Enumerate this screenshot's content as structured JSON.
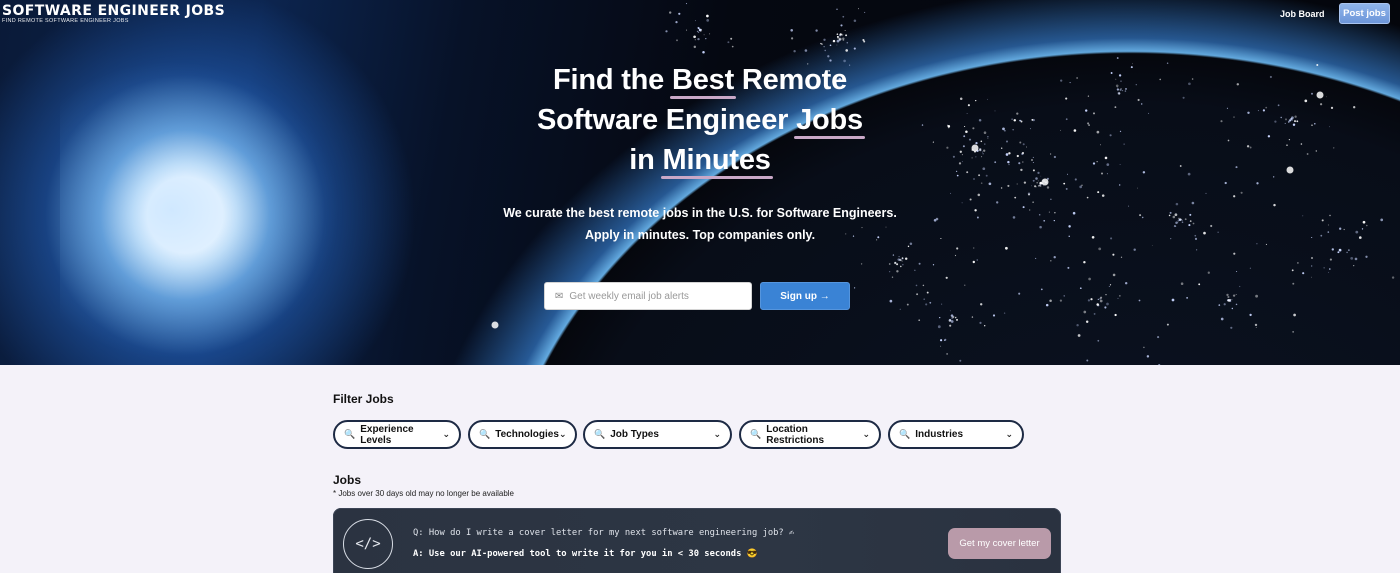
{
  "brand": {
    "title": "SOFTWARE ENGINEER JOBS",
    "subtitle": "FIND REMOTE SOFTWARE ENGINEER JOBS"
  },
  "nav": {
    "job_board": "Job Board",
    "post_jobs": "Post jobs"
  },
  "hero": {
    "headline_parts": {
      "w1": "Find the ",
      "w2": "Best",
      "w3": " Remote",
      "w4": "Software Engineer ",
      "w5": "Jobs",
      "w6": "in ",
      "w7": "Minutes"
    },
    "sub1": "We curate the best remote jobs in the U.S. for Software Engineers.",
    "sub2": "Apply in minutes. Top companies only.",
    "email_placeholder": "Get weekly email job alerts",
    "mail_icon": "✉",
    "signup_label": "Sign up →"
  },
  "filters": {
    "title": "Filter Jobs",
    "items": [
      {
        "label": "Experience Levels"
      },
      {
        "label": "Technologies"
      },
      {
        "label": "Job Types"
      },
      {
        "label": "Location Restrictions"
      },
      {
        "label": "Industries"
      }
    ]
  },
  "jobs": {
    "title": "Jobs",
    "note": "* Jobs over 30 days old may no longer be available"
  },
  "cover_letter": {
    "logo": "</>",
    "question": "Q: How do I write a cover letter for my next software engineering job? ✍",
    "answer": "A: Use our AI-powered tool to write it for you in < 30 seconds 😎",
    "button": "Get my cover letter"
  }
}
